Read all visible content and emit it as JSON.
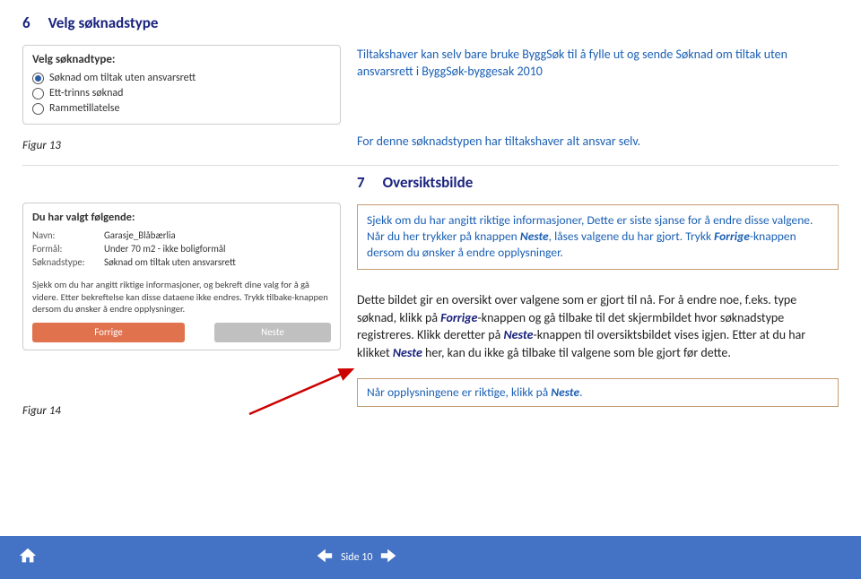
{
  "section6": {
    "number": "6",
    "title": "Velg søknadstype",
    "radio_panel": {
      "heading": "Velg søknadtype:",
      "options": [
        {
          "label": "Søknad om tiltak uten ansvarsrett",
          "selected": true
        },
        {
          "label": "Ett-trinns søknad",
          "selected": false
        },
        {
          "label": "Rammetillatelse",
          "selected": false
        }
      ]
    },
    "fig_caption": "Figur 13",
    "intro_text": "Tiltakshaver kan selv bare bruke ByggSøk til å fylle ut og sende Søknad om tiltak uten ansvarsrett i ByggSøk-byggesak 2010",
    "ansvar_text": "For denne søknadstypen har tiltakshaver alt ansvar selv."
  },
  "section7": {
    "number": "7",
    "title": "Oversiktsbilde",
    "box1_pre": "Sjekk om du har angitt riktige informasjoner, Dette er siste sjanse for å endre disse valgene. Når du her trykker på knappen ",
    "box1_btn1": "Neste",
    "box1_mid1": ", låses valgene du har gjort. Trykk ",
    "box1_btn2": "Forrige",
    "box1_mid2": "-knappen dersom du ønsker å endre opplysninger.",
    "overview": {
      "heading": "Du har valgt følgende:",
      "name_key": "Navn:",
      "name_val": "Garasje_Blåbærlia",
      "formal_key": "Formål:",
      "formal_val": "Under 70 m2 - ikke boligformål",
      "type_key": "Søknadstype:",
      "type_val": "Søknad om tiltak uten ansvarsrett",
      "instr": "Sjekk om du har angitt riktige informasjoner, og bekreft dine valg for å gå videre. Etter bekreftelse kan disse dataene ikke endres. Trykk tilbake-knappen dersom du ønsker å endre opplysninger.",
      "btn_prev": "Forrige",
      "btn_next": "Neste"
    },
    "fig_caption": "Figur 14",
    "body_p1a": "Dette bildet gir en oversikt over valgene som er gjort til nå. For å endre noe, f.eks. type søknad, klikk på ",
    "body_em1": "Forrige",
    "body_p1b": "-knappen og gå tilbake til det skjermbildet hvor søknadstype registreres. Klikk deretter på ",
    "body_em2": "Neste",
    "body_p1c": "-knappen til oversiktsbildet vises igjen. Etter at du har klikket ",
    "body_em3": "Neste",
    "body_p1d": " her, kan du ikke gå tilbake til valgene som ble gjort før dette.",
    "box2_pre": "Når opplysningene er riktige, klikk på ",
    "box2_btn": "Neste",
    "box2_post": "."
  },
  "footer": {
    "page_label": "Side 10"
  }
}
